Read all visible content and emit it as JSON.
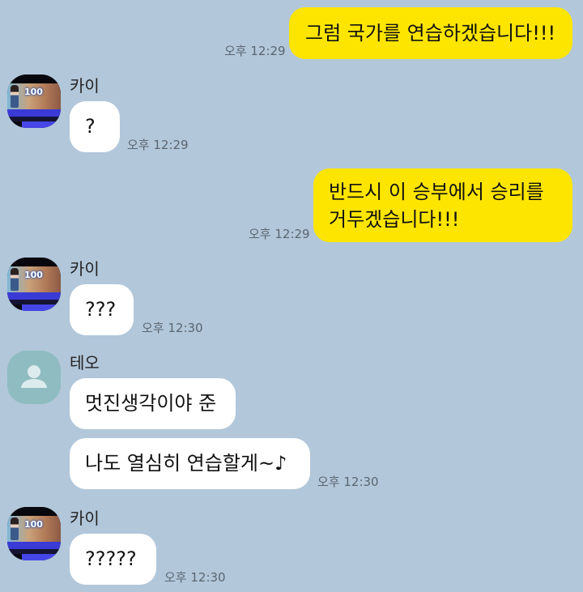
{
  "messages": [
    {
      "id": "m1",
      "sender": "me",
      "text": "그럼 국가를 연습하겠습니다!!!",
      "time": "오후 12:29"
    },
    {
      "id": "m2",
      "sender": "카이",
      "avatar": "kai-avatar",
      "text": "?",
      "time": "오후 12:29"
    },
    {
      "id": "m3",
      "sender": "me",
      "lines": [
        "반드시 이 승부에서 승리를",
        "거두겠습니다!!!"
      ],
      "time": "오후 12:29"
    },
    {
      "id": "m4",
      "sender": "카이",
      "avatar": "kai-avatar",
      "text": "???",
      "time": "오후 12:30"
    },
    {
      "id": "m5",
      "sender": "테오",
      "avatar": "default-person-icon",
      "text": "멋진생각이야 준"
    },
    {
      "id": "m6",
      "sender": "테오",
      "text": "나도 열심히 연습할게~♪",
      "time": "오후 12:30"
    },
    {
      "id": "m7",
      "sender": "카이",
      "avatar": "kai-avatar",
      "text": "?????",
      "time": "오후 12:30"
    }
  ],
  "avatar_kai": {
    "badge_text": "100"
  },
  "colors": {
    "background": "#b2c7da",
    "my_bubble": "#fee500",
    "their_bubble": "#ffffff",
    "time_text": "#5b6670",
    "teo_avatar": "#8fbcc1"
  }
}
